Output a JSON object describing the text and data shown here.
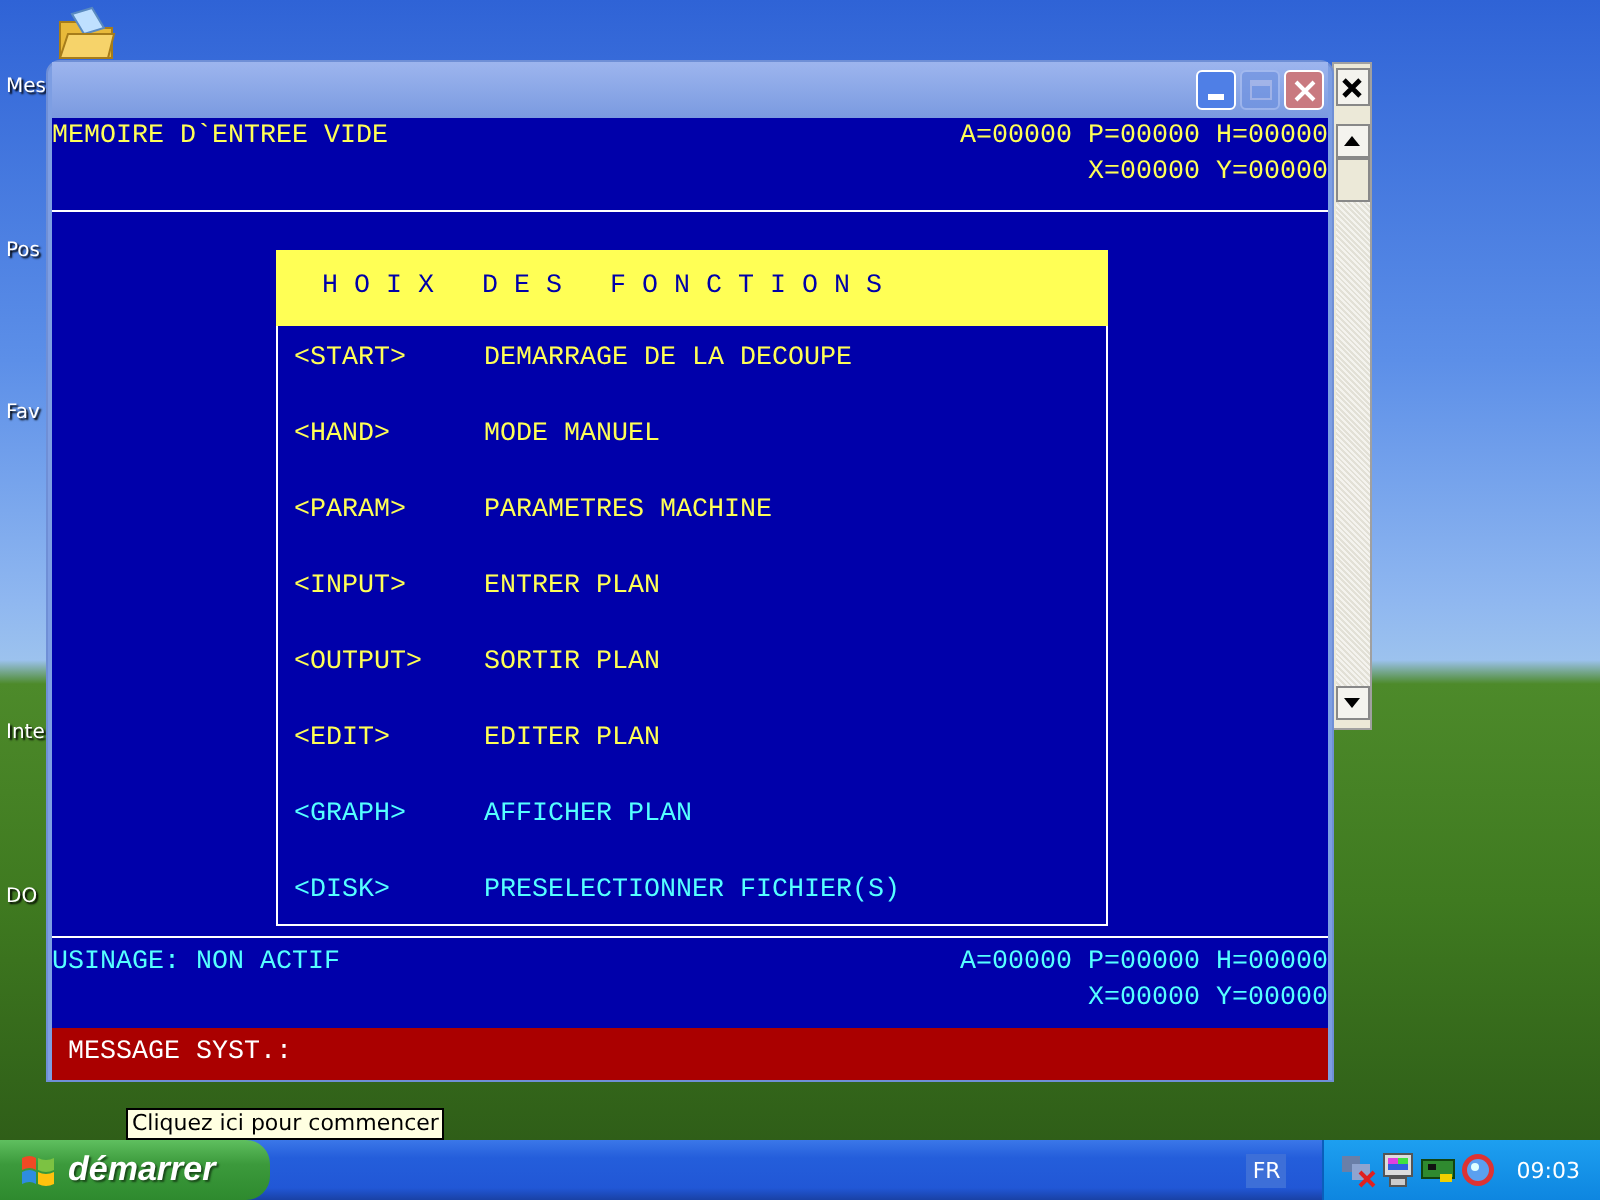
{
  "desktop": {
    "icon_labels": [
      {
        "label": "Mes"
      },
      {
        "label": "Pos"
      },
      {
        "label": "Fav"
      },
      {
        "label": "Inte"
      },
      {
        "label": "DO"
      }
    ]
  },
  "window": {
    "buttons": [
      {
        "kind": "minimize",
        "disabled": false
      },
      {
        "kind": "maximize",
        "disabled": true
      },
      {
        "kind": "close",
        "disabled": false
      }
    ],
    "top_status": {
      "message": "MEMOIRE D`ENTREE VIDE",
      "coords_line1": "A=00000 P=00000 H=00000",
      "coords_line2": "X=00000 Y=00000"
    },
    "menu": {
      "title": "HOIX DES FONCTIONS",
      "items": [
        {
          "key": "<START>",
          "label": "DEMARRAGE DE LA DECOUPE",
          "color": "#ffff55"
        },
        {
          "key": "<HAND>",
          "label": "MODE MANUEL",
          "color": "#ffff55"
        },
        {
          "key": "<PARAM>",
          "label": "PARAMETRES MACHINE",
          "color": "#ffff55"
        },
        {
          "key": "<INPUT>",
          "label": "ENTRER PLAN",
          "color": "#ffff55"
        },
        {
          "key": "<OUTPUT>",
          "label": "SORTIR PLAN",
          "color": "#ffff55"
        },
        {
          "key": "<EDIT>",
          "label": "EDITER PLAN",
          "color": "#ffff55"
        },
        {
          "key": "<GRAPH>",
          "label": "AFFICHER PLAN",
          "color": "#55ffff"
        },
        {
          "key": "<DISK>",
          "label": "PRESELECTIONNER FICHIER(S)",
          "color": "#55ffff"
        }
      ]
    },
    "bottom_status": {
      "message": "USINAGE: NON ACTIF",
      "coords_line1": "A=00000 P=00000 H=00000",
      "coords_line2": "X=00000 Y=00000"
    },
    "message_bar": {
      "label": "MESSAGE SYST.:"
    }
  },
  "tooltip": "Cliquez ici pour commencer",
  "taskbar": {
    "start_label": "démarrer",
    "language": "FR",
    "clock": "09:03"
  }
}
